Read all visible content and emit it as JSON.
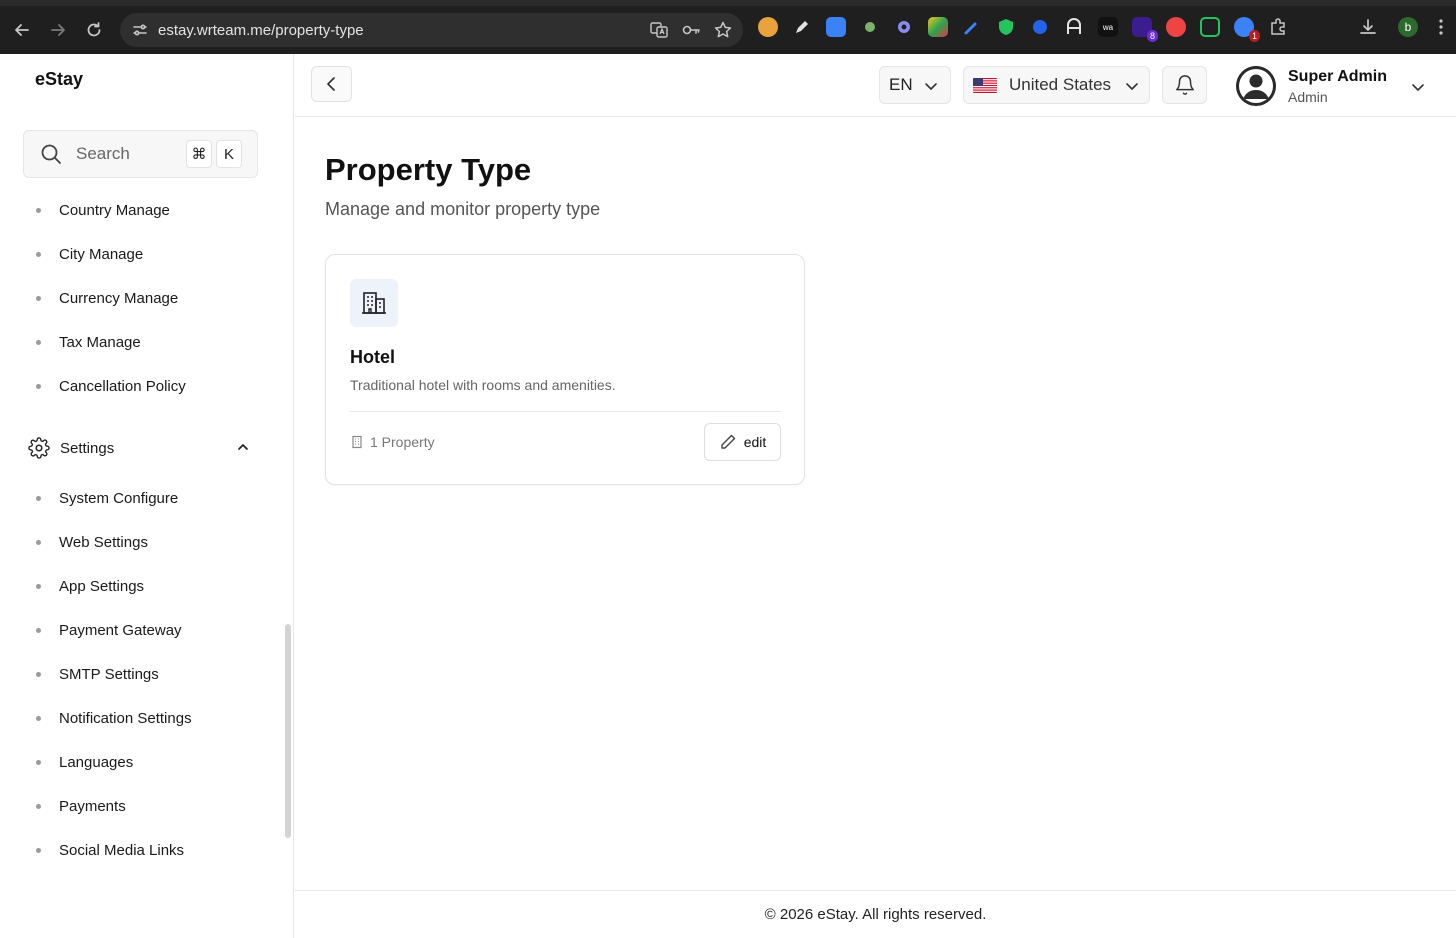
{
  "browser": {
    "url": "estay.wrteam.me/property-type",
    "profile_initial": "b",
    "ext_badge_1": "8",
    "ext_badge_2": "1"
  },
  "sidebar": {
    "brand": "eStay",
    "search": {
      "placeholder": "Search",
      "shortcut_mod": "⌘",
      "shortcut_key": "K"
    },
    "items_top": [
      {
        "label": "Country Manage"
      },
      {
        "label": "City Manage"
      },
      {
        "label": "Currency Manage"
      },
      {
        "label": "Tax Manage"
      },
      {
        "label": "Cancellation Policy"
      }
    ],
    "settings_group": {
      "label": "Settings",
      "expanded": true
    },
    "settings_items": [
      {
        "label": "System Configure"
      },
      {
        "label": "Web Settings"
      },
      {
        "label": "App Settings"
      },
      {
        "label": "Payment Gateway"
      },
      {
        "label": "SMTP Settings"
      },
      {
        "label": "Notification Settings"
      },
      {
        "label": "Languages"
      },
      {
        "label": "Payments"
      },
      {
        "label": "Social Media Links"
      }
    ]
  },
  "header": {
    "language": "EN",
    "country": "United States",
    "user": {
      "name": "Super Admin",
      "role": "Admin"
    }
  },
  "main": {
    "title": "Property Type",
    "subtitle": "Manage and monitor property type",
    "cards": [
      {
        "icon": "building-icon",
        "title": "Hotel",
        "description": "Traditional hotel with rooms and amenities.",
        "meta": "1 Property",
        "action_label": "edit"
      }
    ]
  },
  "footer": {
    "text": "© 2026 eStay. All rights reserved."
  },
  "colors": {
    "card_icon_bg": "#eef2fb",
    "chrome_bg": "#1f1f1f",
    "border": "#e6e6e6"
  }
}
